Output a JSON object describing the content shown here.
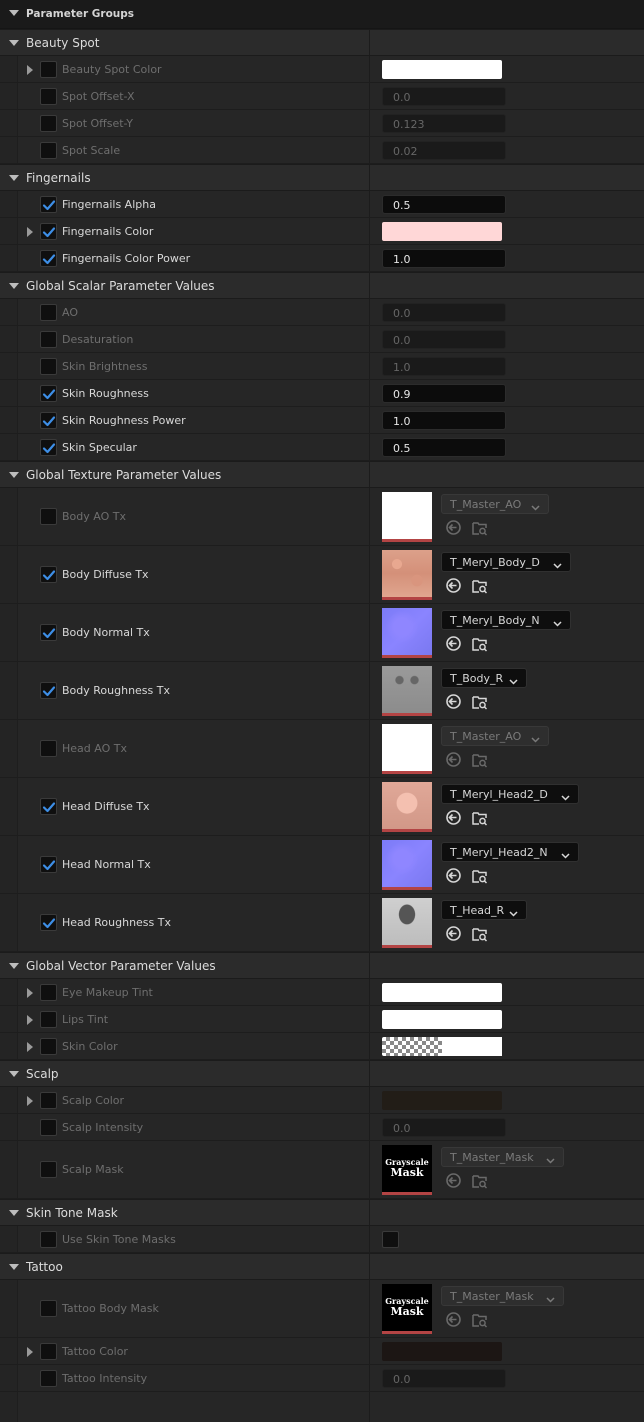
{
  "panel": {
    "title": "Parameter Groups"
  },
  "groups": [
    {
      "label": "Beauty Spot",
      "rows": [
        {
          "label": "Beauty Spot Color",
          "type": "color",
          "enabled": false,
          "expandable": true,
          "color": "#ffffff"
        },
        {
          "label": "Spot Offset-X",
          "type": "scalar",
          "enabled": false,
          "value": "0.0"
        },
        {
          "label": "Spot Offset-Y",
          "type": "scalar",
          "enabled": false,
          "value": "0.123"
        },
        {
          "label": "Spot Scale",
          "type": "scalar",
          "enabled": false,
          "value": "0.02"
        }
      ]
    },
    {
      "label": "Fingernails",
      "rows": [
        {
          "label": "Fingernails Alpha",
          "type": "scalar",
          "enabled": true,
          "value": "0.5"
        },
        {
          "label": "Fingernails Color",
          "type": "color",
          "enabled": true,
          "expandable": true,
          "color": "#ffd7d7"
        },
        {
          "label": "Fingernails Color Power",
          "type": "scalar",
          "enabled": true,
          "value": "1.0"
        }
      ]
    },
    {
      "label": "Global Scalar Parameter Values",
      "rows": [
        {
          "label": "AO",
          "type": "scalar",
          "enabled": false,
          "value": "0.0"
        },
        {
          "label": "Desaturation",
          "type": "scalar",
          "enabled": false,
          "value": "0.0"
        },
        {
          "label": "Skin Brightness",
          "type": "scalar",
          "enabled": false,
          "value": "1.0"
        },
        {
          "label": "Skin Roughness",
          "type": "scalar",
          "enabled": true,
          "value": "0.9"
        },
        {
          "label": "Skin Roughness Power",
          "type": "scalar",
          "enabled": true,
          "value": "1.0"
        },
        {
          "label": "Skin Specular",
          "type": "scalar",
          "enabled": true,
          "value": "0.5"
        }
      ]
    },
    {
      "label": "Global Texture Parameter Values",
      "rows": [
        {
          "label": "Body AO Tx",
          "type": "texture",
          "enabled": false,
          "asset": "T_Master_AO",
          "thumb": "white"
        },
        {
          "label": "Body Diffuse Tx",
          "type": "texture",
          "enabled": true,
          "asset": "T_Meryl_Body_D",
          "thumb": "skin"
        },
        {
          "label": "Body Normal Tx",
          "type": "texture",
          "enabled": true,
          "asset": "T_Meryl_Body_N",
          "thumb": "normal"
        },
        {
          "label": "Body Roughness Tx",
          "type": "texture",
          "enabled": true,
          "asset": "T_Body_R",
          "thumb": "gray"
        },
        {
          "label": "Head AO Tx",
          "type": "texture",
          "enabled": false,
          "asset": "T_Master_AO",
          "thumb": "white"
        },
        {
          "label": "Head Diffuse Tx",
          "type": "texture",
          "enabled": true,
          "asset": "T_Meryl_Head2_D",
          "thumb": "face"
        },
        {
          "label": "Head Normal Tx",
          "type": "texture",
          "enabled": true,
          "asset": "T_Meryl_Head2_N",
          "thumb": "normal"
        },
        {
          "label": "Head Roughness Tx",
          "type": "texture",
          "enabled": true,
          "asset": "T_Head_R",
          "thumb": "grayhead"
        }
      ]
    },
    {
      "label": "Global Vector Parameter Values",
      "rows": [
        {
          "label": "Eye Makeup Tint",
          "type": "color",
          "enabled": false,
          "expandable": true,
          "color": "#ffffff"
        },
        {
          "label": "Lips Tint",
          "type": "color",
          "enabled": false,
          "expandable": true,
          "color": "#ffffff"
        },
        {
          "label": "Skin Color",
          "type": "color",
          "enabled": false,
          "expandable": true,
          "color": "checker"
        }
      ]
    },
    {
      "label": "Scalp",
      "rows": [
        {
          "label": "Scalp Color",
          "type": "color",
          "enabled": false,
          "expandable": true,
          "color": "#221d17"
        },
        {
          "label": "Scalp Intensity",
          "type": "scalar",
          "enabled": false,
          "value": "0.0"
        },
        {
          "label": "Scalp Mask",
          "type": "texture",
          "enabled": false,
          "asset": "T_Master_Mask",
          "thumb": "mask"
        }
      ]
    },
    {
      "label": "Skin Tone Mask",
      "rows": [
        {
          "label": "Use Skin Tone Masks",
          "type": "bool",
          "enabled": false
        }
      ]
    },
    {
      "label": "Tattoo",
      "rows": [
        {
          "label": "Tattoo Body Mask",
          "type": "texture",
          "enabled": false,
          "asset": "T_Master_Mask",
          "thumb": "mask"
        },
        {
          "label": "Tattoo Color",
          "type": "color",
          "enabled": false,
          "expandable": true,
          "color": "#1c1614"
        },
        {
          "label": "Tattoo Intensity",
          "type": "scalar",
          "enabled": false,
          "value": "0.0"
        }
      ]
    }
  ],
  "mask_thumb": {
    "line1": "Grayscale",
    "line2": "Mask"
  },
  "colors": {
    "accent_check": "#3d8ee6",
    "texture_border": "#b34444"
  },
  "icons": {
    "use_selected": "arrow-use-icon",
    "browse": "browse-asset-icon",
    "combo": "chevron-down-icon",
    "check": "checkmark-icon"
  }
}
